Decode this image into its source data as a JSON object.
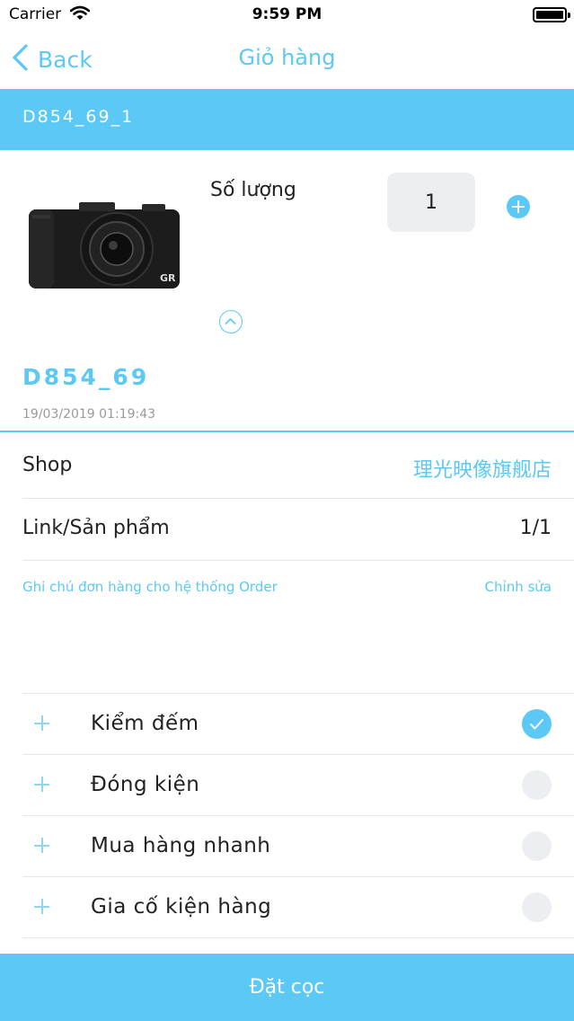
{
  "status_bar": {
    "carrier": "Carrier",
    "time": "9:59 PM"
  },
  "nav": {
    "back_label": "Back",
    "title": "Giỏ hàng"
  },
  "order_header": {
    "code": "D854_69_1"
  },
  "product": {
    "quantity_label": "Số lượng",
    "quantity": "1",
    "brand_mark": "GR"
  },
  "order": {
    "code": "D854_69",
    "date": "19/03/2019 01:19:43"
  },
  "info": {
    "shop_label": "Shop",
    "shop_value": "理光映像旗舰店",
    "link_label": "Link/Sản phẩm",
    "link_value": "1/1",
    "note_label": "Ghi chú đơn hàng cho hệ thống Order",
    "note_edit": "Chỉnh sửa"
  },
  "services": [
    {
      "label": "Kiểm đếm",
      "checked": true
    },
    {
      "label": "Đóng kiện",
      "checked": false
    },
    {
      "label": "Mua hàng nhanh",
      "checked": false
    },
    {
      "label": "Gia cố kiện hàng",
      "checked": false
    }
  ],
  "actions": {
    "deposit_label": "Đặt cọc"
  },
  "colors": {
    "accent": "#5bc8f5",
    "field_bg": "#eceef1",
    "divider": "#e6e6e6"
  }
}
